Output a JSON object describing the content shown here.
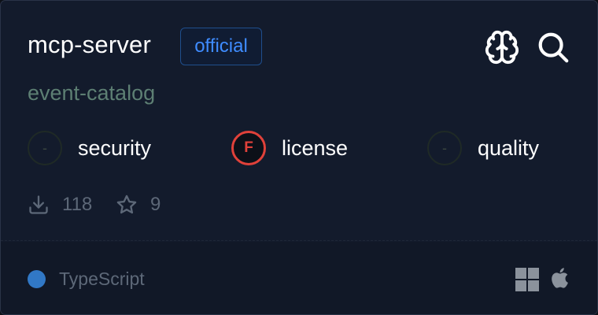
{
  "card": {
    "title": "mcp-server",
    "badge": "official",
    "subtitle": "event-catalog",
    "icons": {
      "brain": "brain-icon",
      "search": "search-icon"
    },
    "metrics": [
      {
        "grade": "-",
        "label": "security",
        "status": "unknown"
      },
      {
        "grade": "F",
        "label": "license",
        "status": "fail"
      },
      {
        "grade": "-",
        "label": "quality",
        "status": "unknown"
      }
    ],
    "stats": {
      "downloads": "118",
      "stars": "9"
    },
    "footer": {
      "language": "TypeScript",
      "language_color": "#3178c6",
      "platforms": [
        "windows-icon",
        "apple-icon"
      ]
    }
  },
  "colors": {
    "background": "#131b2c",
    "badge_text": "#3f8cff",
    "fail": "#e0413a",
    "subtitle": "#5d7f73"
  }
}
